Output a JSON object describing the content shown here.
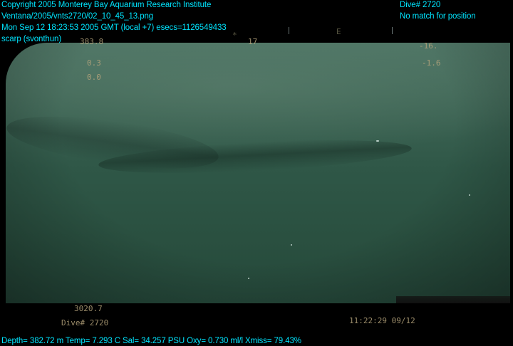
{
  "overlay": {
    "line1": "Copyright 2005 Monterey Bay Aquarium Research Institute",
    "line2": "Ventana/2005/vnts2720/02_10_45_13.png",
    "line3": "Mon Sep 12 18:23:53 2005 GMT (local +7)  esecs=1126549433",
    "line4": "scarp (svonthun)",
    "dive": "Dive# 2720",
    "position": "No match for position",
    "sensors": "Depth= 382.72 m  Temp= 7.293 C  Sal= 34.257 PSU  Oxy= 0.730 ml/l  Xmiss= 79.43%"
  },
  "camera": {
    "heading_mark": "E",
    "top_left_val": "383.8",
    "top_mid_val": "17",
    "top_right_val": "-16.",
    "left_val2": "0.3",
    "left_val3": "0.0",
    "right_val2": "-1.6",
    "bottom_val": "3020.7",
    "dive_label": "Dive# 2720",
    "timestamp": "11:22:29 09/12"
  },
  "colors": {
    "overlay_text": "#00e5ff",
    "camera_text": "#b6a47c",
    "water": "#2f5747"
  }
}
